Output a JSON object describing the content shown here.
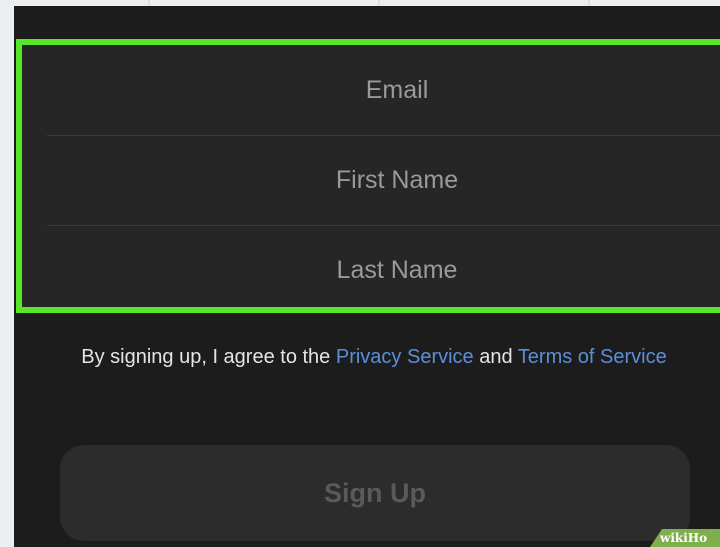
{
  "form": {
    "email_placeholder": "Email",
    "first_name_placeholder": "First Name",
    "last_name_placeholder": "Last Name",
    "highlight_color": "#56e62a"
  },
  "terms": {
    "prefix": "By signing up, I agree to the ",
    "privacy_link": "Privacy Service",
    "middle": " and ",
    "terms_link": "Terms of Service"
  },
  "signup": {
    "label": "Sign Up"
  },
  "watermark": {
    "text": "wikiHo"
  }
}
